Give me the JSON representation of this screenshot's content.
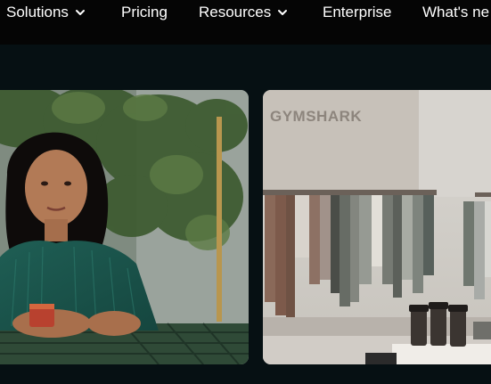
{
  "nav": {
    "items": [
      {
        "label": "Solutions",
        "has_dropdown": true
      },
      {
        "label": "Pricing",
        "has_dropdown": false
      },
      {
        "label": "Resources",
        "has_dropdown": true
      },
      {
        "label": "Enterprise",
        "has_dropdown": false
      },
      {
        "label": "What's ne",
        "has_dropdown": false
      }
    ]
  },
  "cards": {
    "store_sign": "GYMSHARK"
  },
  "colors": {
    "nav_bg": "#050505",
    "page_bg": "#061013",
    "text": "#ffffff"
  }
}
